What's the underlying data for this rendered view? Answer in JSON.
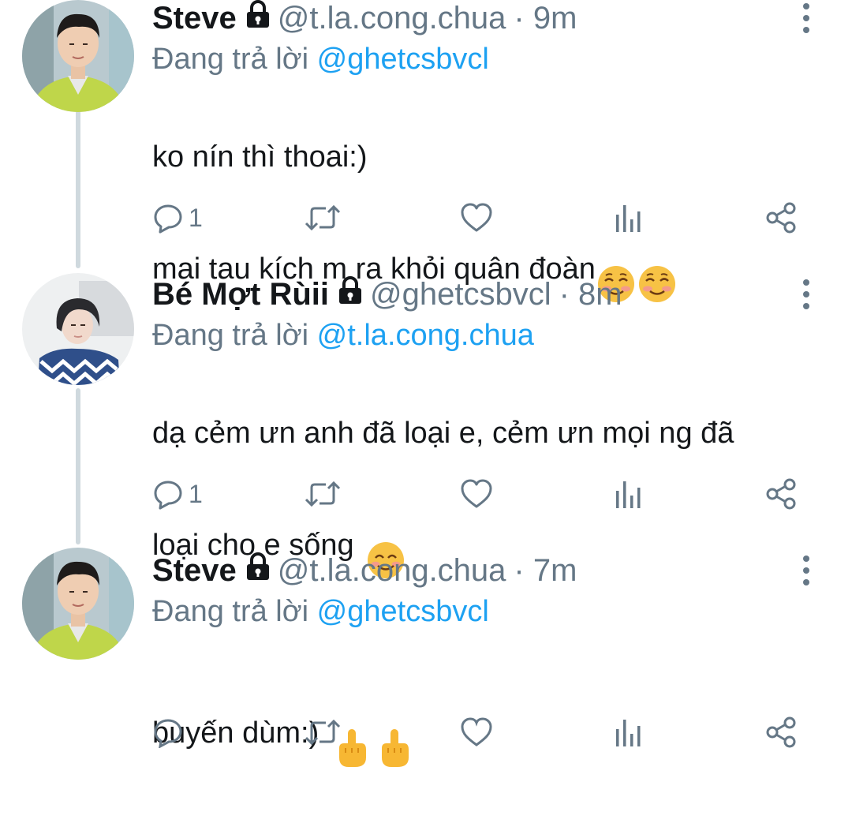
{
  "reply_prefix": "Đang trả lời",
  "tweets": [
    {
      "name": "Steve",
      "handle": "@t.la.cong.chua",
      "time": "· 9m",
      "reply_to": "@ghetcsbvcl",
      "line1": "ko nín thì thoai:)",
      "line2": "mai tau kích m ra khỏi quân đoàn",
      "emojis": [
        "smiling-face-emoji",
        "smiling-face-emoji"
      ],
      "reply_count": "1"
    },
    {
      "name": "Bé Mợt Rùii",
      "handle": "@ghetcsbvcl",
      "time": "· 8m",
      "reply_to": "@t.la.cong.chua",
      "line1": "dạ cẻm ưn anh đã loại e, cẻm ưn mọi ng đã",
      "line2": "loại cho e sống",
      "emojis": [
        "smiling-face-with-smiling-eyes-emoji"
      ],
      "reply_count": "1"
    },
    {
      "name": "Steve",
      "handle": "@t.la.cong.chua",
      "time": "· 7m",
      "reply_to": "@ghetcsbvcl",
      "line1": "buyến dùm:)",
      "emojis": [
        "middle-finger-emoji",
        "middle-finger-emoji"
      ]
    }
  ],
  "colors": {
    "name": "#14171a",
    "secondary": "#657786",
    "mention": "#1da1f2",
    "thread_line": "#cfd9de",
    "background": "#ffffff"
  },
  "icons": [
    "lock-icon",
    "more-icon",
    "reply-icon",
    "retweet-icon",
    "like-icon",
    "analytics-icon",
    "share-icon"
  ]
}
